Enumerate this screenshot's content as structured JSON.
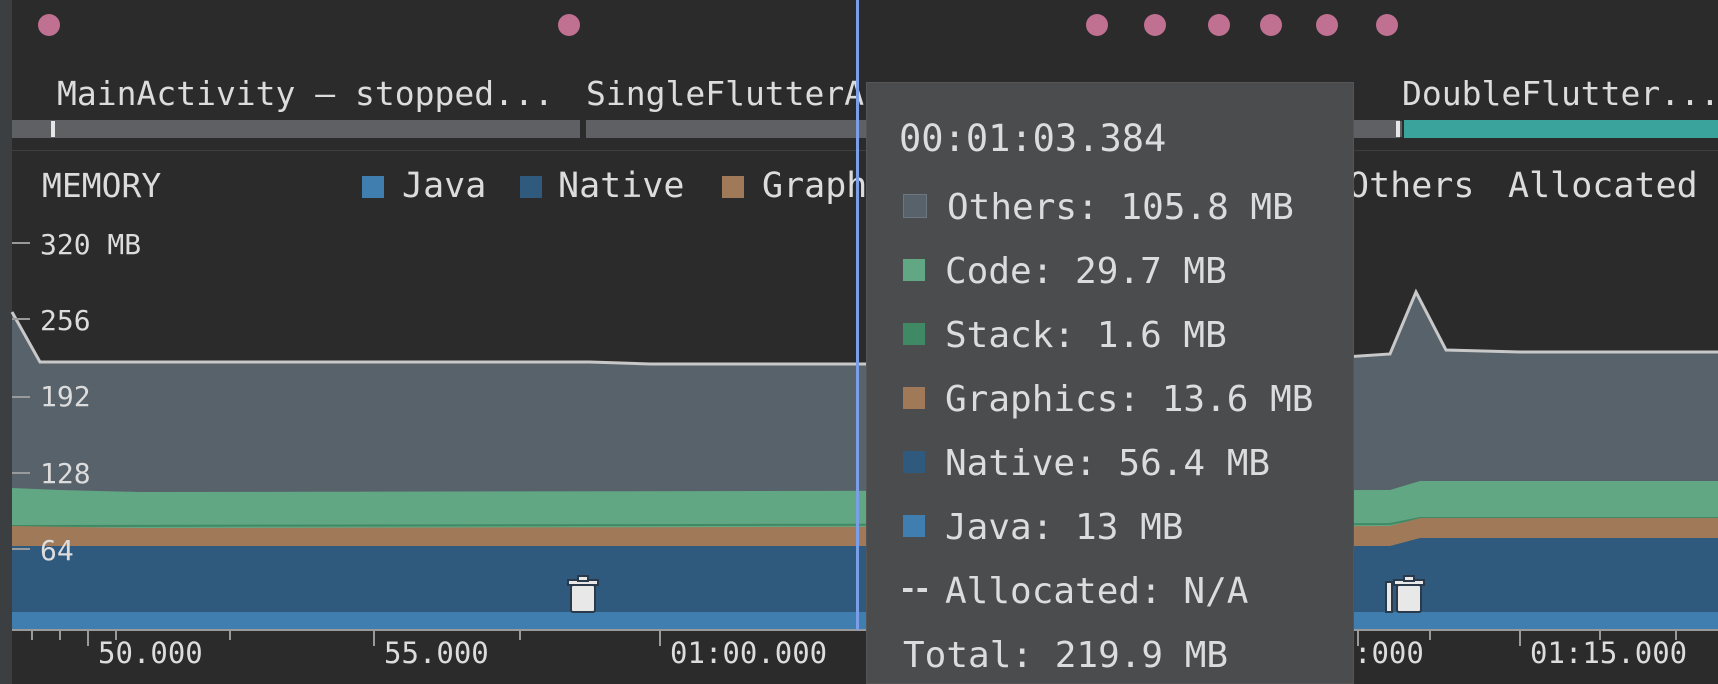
{
  "colors": {
    "event_dot": "#c07090",
    "others": "#57626b",
    "code": "#62a784",
    "stack": "#3f8a65",
    "graphics": "#a07a58",
    "native": "#2f5a7d",
    "java": "#3f7eaf",
    "cursor": "#7a9ee8",
    "activity_teal": "#3aa39b"
  },
  "activities": {
    "main": "MainActivity – stopped...",
    "single": "SingleFlutterA",
    "double": "DoubleFlutter..."
  },
  "memory": {
    "title": "MEMORY",
    "legend": {
      "java": "Java",
      "native": "Native",
      "graphics": "Graph",
      "others": "Others",
      "allocated": "Allocated"
    }
  },
  "y_axis": [
    "320 MB",
    "256",
    "192",
    "128",
    "64"
  ],
  "x_axis": [
    "50.000",
    "55.000",
    "01:00.000",
    ":000",
    "01:15.000"
  ],
  "icons": {
    "trash": "trash-icon"
  },
  "tooltip": {
    "time": "00:01:03.384",
    "others": "Others: 105.8 MB",
    "code": "Code: 29.7 MB",
    "stack": "Stack: 1.6 MB",
    "graphics": "Graphics: 13.6 MB",
    "native": "Native: 56.4 MB",
    "java": "Java: 13 MB",
    "allocated": "Allocated: N/A",
    "total": "Total: 219.9 MB"
  }
}
